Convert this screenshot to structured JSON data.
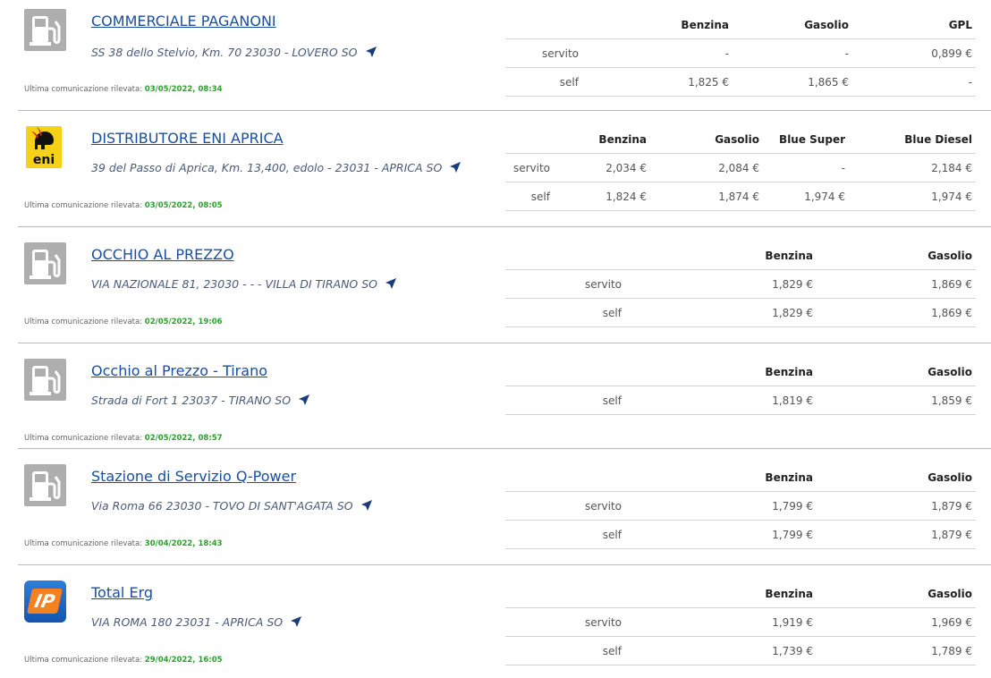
{
  "update_label": "Ultima comunicazione rilevata:",
  "stations": [
    {
      "name": "COMMERCIALE PAGANONI",
      "address": "SS 38 dello Stelvio, Km. 70 23030 - LOVERO SO",
      "updated": "03/05/2022, 08:34",
      "logo": "generic",
      "fuels": [
        "Benzina",
        "Gasolio",
        "GPL"
      ],
      "rows": [
        {
          "mode": "servito",
          "prices": [
            "-",
            "-",
            "0,899 €"
          ]
        },
        {
          "mode": "self",
          "prices": [
            "1,825 €",
            "1,865 €",
            "-"
          ]
        }
      ]
    },
    {
      "name": "DISTRIBUTORE ENI APRICA",
      "address": "39 del Passo di Aprica, Km. 13,400, edolo - 23031 - APRICA SO",
      "updated": "03/05/2022, 08:05",
      "logo": "eni",
      "fuels": [
        "Benzina",
        "Gasolio",
        "Blue Super",
        "Blue Diesel"
      ],
      "rows": [
        {
          "mode": "servito",
          "prices": [
            "2,034 €",
            "2,084 €",
            "-",
            "2,184 €"
          ]
        },
        {
          "mode": "self",
          "prices": [
            "1,824 €",
            "1,874 €",
            "1,974 €",
            "1,974 €"
          ]
        }
      ]
    },
    {
      "name": "OCCHIO AL PREZZO",
      "address": "VIA NAZIONALE 81, 23030 - - - VILLA DI TIRANO SO",
      "updated": "02/05/2022, 19:06",
      "logo": "generic",
      "fuels": [
        "Benzina",
        "Gasolio"
      ],
      "rows": [
        {
          "mode": "servito",
          "prices": [
            "1,829 €",
            "1,869 €"
          ]
        },
        {
          "mode": "self",
          "prices": [
            "1,829 €",
            "1,869 €"
          ]
        }
      ]
    },
    {
      "name": "Occhio al Prezzo - Tirano",
      "address": "Strada di Fort 1 23037 - TIRANO SO",
      "updated": "02/05/2022, 08:57",
      "logo": "generic",
      "fuels": [
        "Benzina",
        "Gasolio"
      ],
      "rows": [
        {
          "mode": "self",
          "prices": [
            "1,819 €",
            "1,859 €"
          ]
        }
      ]
    },
    {
      "name": "Stazione di Servizio Q-Power",
      "address": "Via Roma 66 23030 - TOVO DI SANT'AGATA SO",
      "updated": "30/04/2022, 18:43",
      "logo": "generic",
      "fuels": [
        "Benzina",
        "Gasolio"
      ],
      "rows": [
        {
          "mode": "servito",
          "prices": [
            "1,799 €",
            "1,879 €"
          ]
        },
        {
          "mode": "self",
          "prices": [
            "1,799 €",
            "1,879 €"
          ]
        }
      ]
    },
    {
      "name": "Total Erg",
      "address": "VIA ROMA 180 23031 - APRICA SO",
      "updated": "29/04/2022, 16:05",
      "logo": "ip",
      "logo_text": "IP",
      "fuels": [
        "Benzina",
        "Gasolio"
      ],
      "rows": [
        {
          "mode": "servito",
          "prices": [
            "1,919 €",
            "1,969 €"
          ]
        },
        {
          "mode": "self",
          "prices": [
            "1,739 €",
            "1,789 €"
          ]
        }
      ]
    }
  ],
  "colors": {
    "link": "#1a4fa0",
    "update_date": "#2ea02e",
    "nav_icon": "#1a3c7a"
  }
}
